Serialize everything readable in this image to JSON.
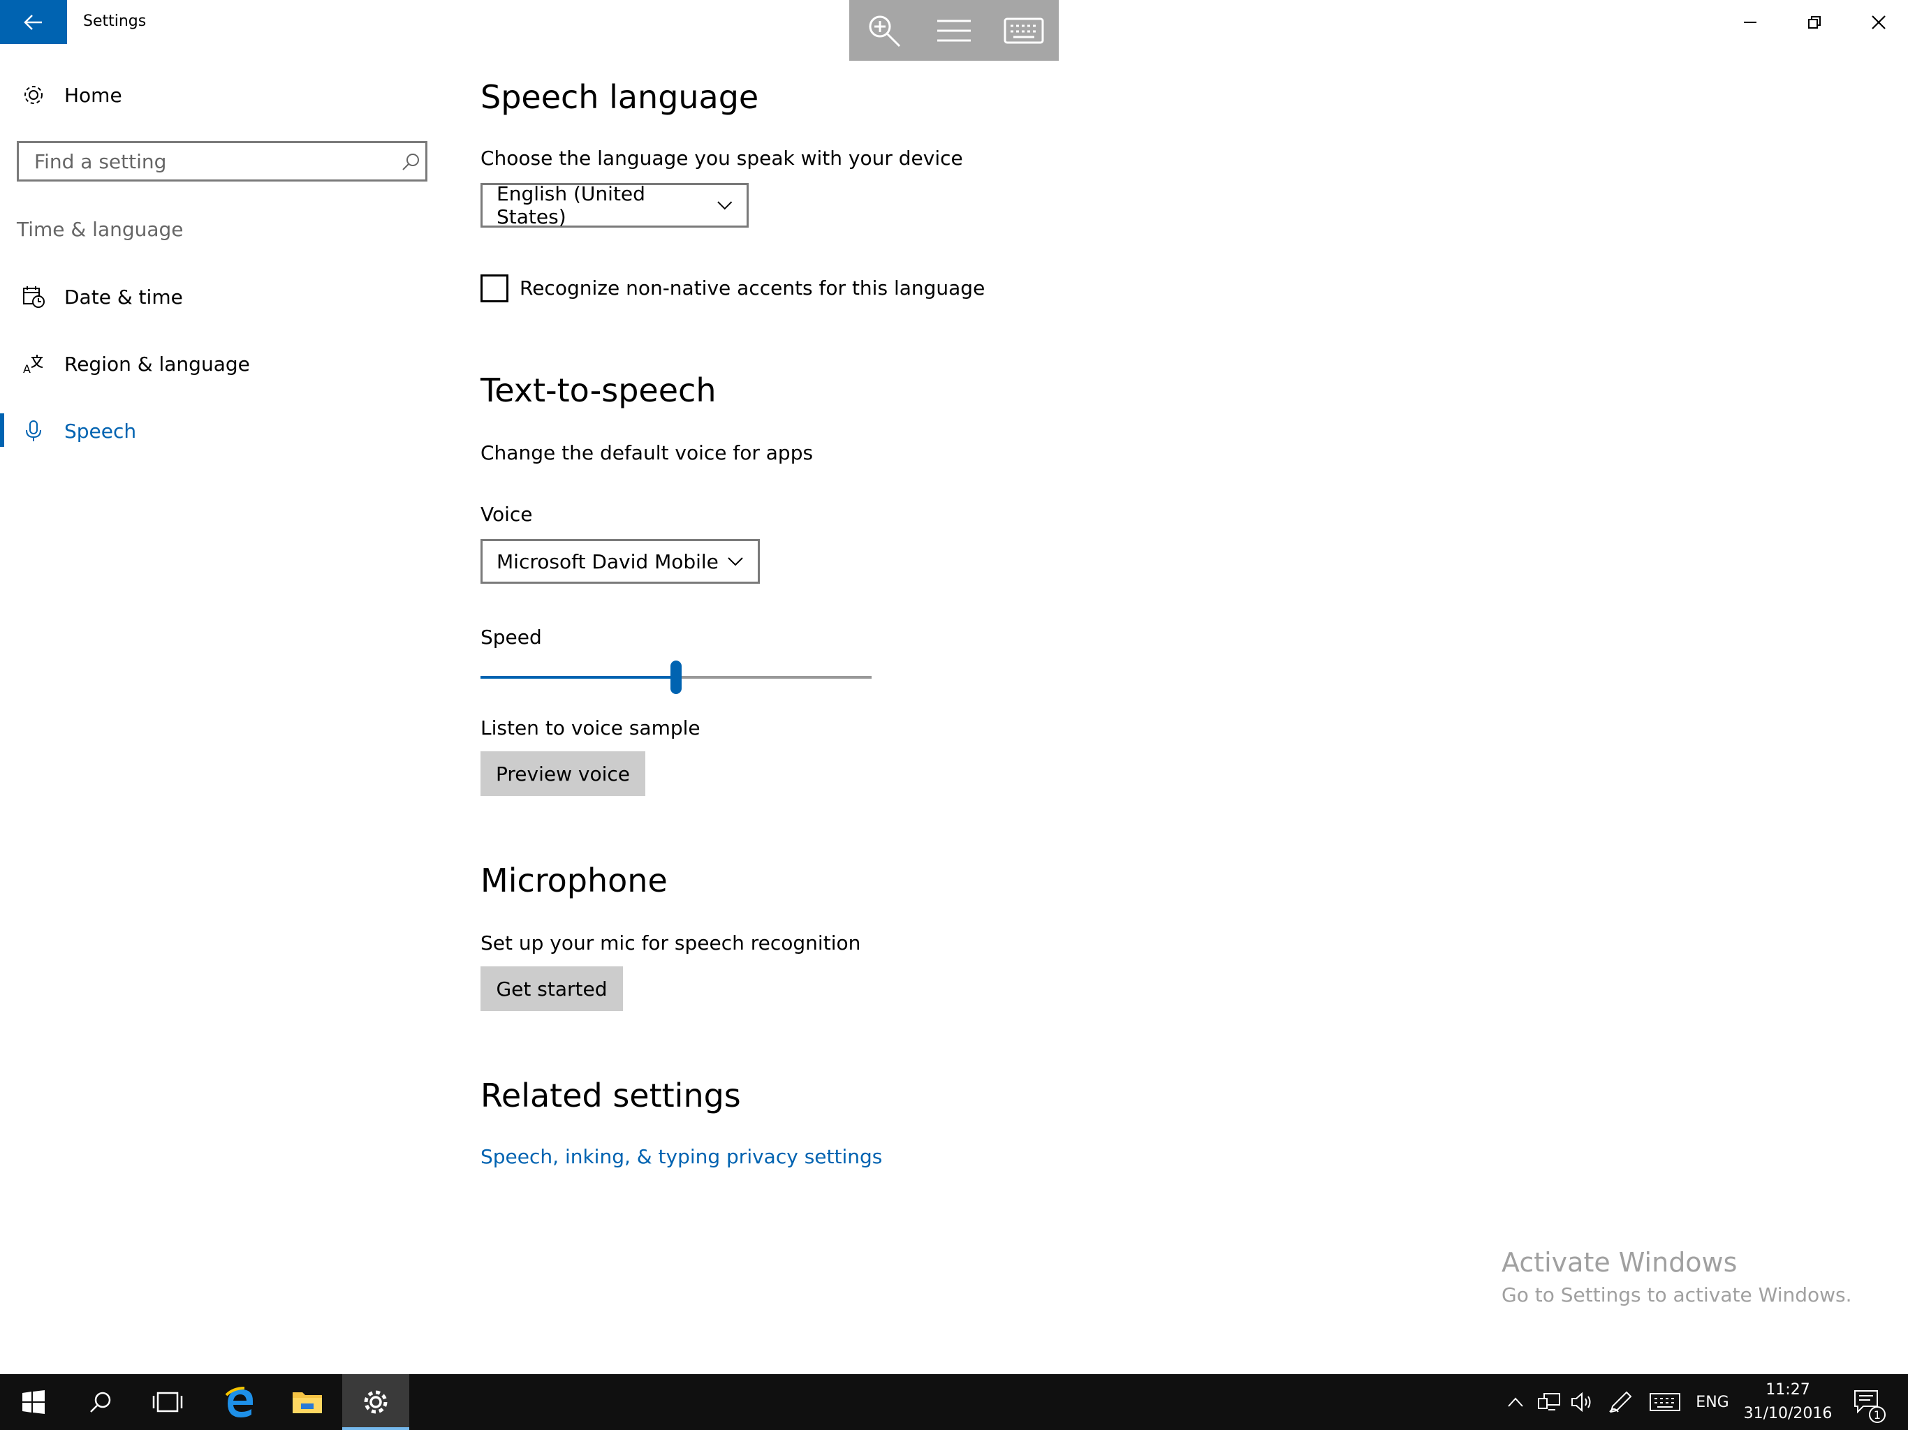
{
  "window": {
    "title": "Settings",
    "controls": [
      "minimize-icon",
      "restore-icon",
      "close-icon"
    ]
  },
  "floating_toolbar": {
    "icons": [
      "zoom-in-icon",
      "menu-icon",
      "keyboard-icon"
    ]
  },
  "sidebar": {
    "home_label": "Home",
    "search_placeholder": "Find a setting",
    "section_label": "Time & language",
    "items": [
      {
        "label": "Date & time",
        "icon": "calendar-clock-icon",
        "selected": false
      },
      {
        "label": "Region & language",
        "icon": "region-language-icon",
        "selected": false
      },
      {
        "label": "Speech",
        "icon": "microphone-icon",
        "selected": true
      }
    ]
  },
  "main": {
    "speech_language": {
      "heading": "Speech language",
      "description": "Choose the language you speak with your device",
      "selected_language": "English (United States)",
      "accent_checkbox_label": "Recognize non-native accents for this language",
      "accent_checked": false
    },
    "tts": {
      "heading": "Text-to-speech",
      "description": "Change the default voice for apps",
      "voice_label": "Voice",
      "voice_value": "Microsoft David Mobile",
      "speed_label": "Speed",
      "speed_fraction": 0.5,
      "sample_label": "Listen to voice sample",
      "preview_button": "Preview voice"
    },
    "microphone": {
      "heading": "Microphone",
      "description": "Set up your mic for speech recognition",
      "button": "Get started"
    },
    "related": {
      "heading": "Related settings",
      "link": "Speech, inking, & typing privacy settings"
    }
  },
  "watermark": {
    "title": "Activate Windows",
    "subtitle": "Go to Settings to activate Windows."
  },
  "taskbar": {
    "apps": [
      "start-icon",
      "search-icon",
      "task-view-icon",
      "edge-icon",
      "file-explorer-icon",
      "settings-icon"
    ],
    "tray": {
      "language": "ENG",
      "time": "11:27",
      "date": "31/10/2016",
      "notification_count": "1"
    }
  },
  "colors": {
    "accent": "#0063b1",
    "taskbar": "#101010",
    "button_gray": "#cccccc"
  }
}
